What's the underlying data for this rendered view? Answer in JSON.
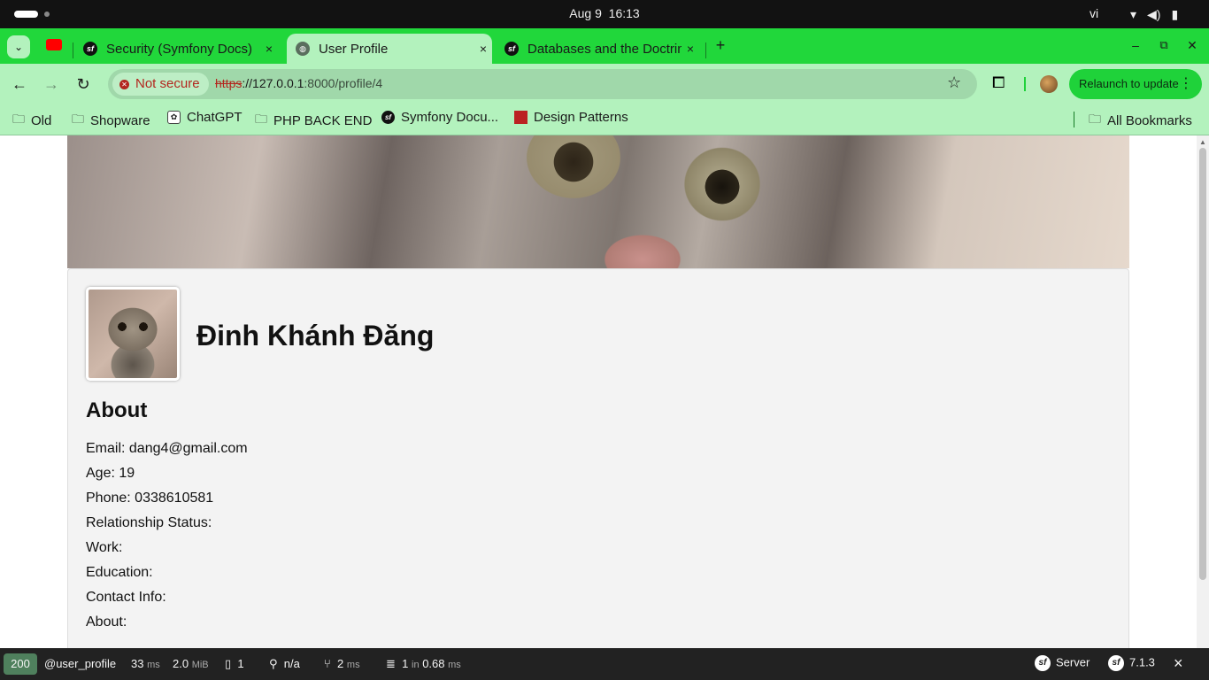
{
  "os": {
    "date": "Aug 9",
    "time": "16:13",
    "input_lang": "vi"
  },
  "browser": {
    "tabs": [
      {
        "title": "Security (Symfony Docs)",
        "close": "×"
      },
      {
        "title": "User Profile",
        "close": "×"
      },
      {
        "title": "Databases and the Doctrine ORM (Symfony Docs)",
        "close": "×"
      }
    ],
    "new_tab": "+",
    "security_chip": "Not secure",
    "url": {
      "scheme": "https",
      "rest": "://127.0.0.1",
      "path": ":8000/profile/4"
    },
    "relaunch_label": "Relaunch to update",
    "bookmarks": [
      "Old",
      "Shopware",
      "ChatGPT",
      "PHP BACK END",
      "Symfony Docu...",
      "Design Patterns"
    ],
    "all_bookmarks": "All Bookmarks"
  },
  "profile": {
    "name": "Đinh Khánh Đăng",
    "about_heading": "About",
    "fields": [
      {
        "label": "Email:",
        "value": "dang4@gmail.com"
      },
      {
        "label": "Age:",
        "value": "19"
      },
      {
        "label": "Phone:",
        "value": "0338610581"
      },
      {
        "label": "Relationship Status:",
        "value": ""
      },
      {
        "label": "Work:",
        "value": ""
      },
      {
        "label": "Education:",
        "value": ""
      },
      {
        "label": "Contact Info:",
        "value": ""
      },
      {
        "label": "About:",
        "value": ""
      }
    ]
  },
  "debug_toolbar": {
    "status_code": "200",
    "route": "@user_profile",
    "time_value": "33",
    "time_unit": "ms",
    "memory_value": "2.0",
    "memory_unit": "MiB",
    "logs": "1",
    "user": "n/a",
    "twig_value": "2",
    "twig_unit": "ms",
    "db_queries": "1",
    "db_in": "in",
    "db_time": "0.68",
    "db_unit": "ms",
    "server_label": "Server",
    "symfony_version": "7.1.3",
    "close": "×"
  },
  "colors": {
    "tab_strip": "#21d73b",
    "toolbar": "#b3f2bd",
    "status_ok": "#4f805d"
  }
}
